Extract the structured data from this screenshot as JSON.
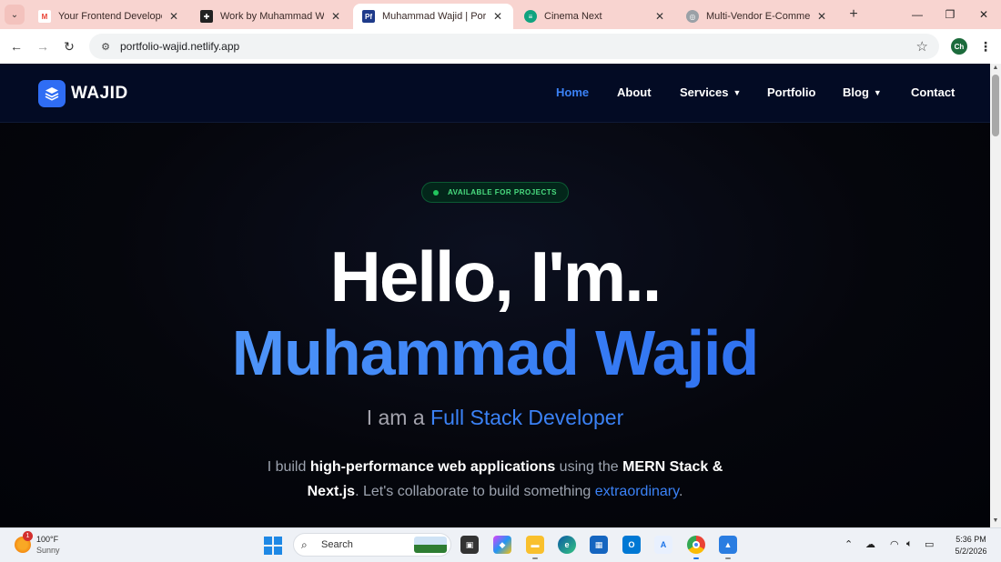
{
  "browser": {
    "tabs": [
      {
        "title": "Your Frontend Developer (Re",
        "favicon": "gmail-icon",
        "active": false
      },
      {
        "title": "Work by Muhammad Wajid",
        "favicon": "work-site-icon",
        "active": false
      },
      {
        "title": "Muhammad Wajid | Portfolio",
        "favicon": "portfolio-icon",
        "active": true
      },
      {
        "title": "Cinema Next",
        "favicon": "cinema-icon",
        "active": false
      },
      {
        "title": "Multi-Vendor E-Commerce P",
        "favicon": "globe-icon",
        "active": false
      }
    ],
    "url": "portfolio-wajid.netlify.app",
    "profile_initials": "Ch"
  },
  "site": {
    "logo_text": "WAJID",
    "nav": [
      {
        "label": "Home",
        "active": true,
        "dropdown": false
      },
      {
        "label": "About",
        "active": false,
        "dropdown": false
      },
      {
        "label": "Services",
        "active": false,
        "dropdown": true
      },
      {
        "label": "Portfolio",
        "active": false,
        "dropdown": false
      },
      {
        "label": "Blog",
        "active": false,
        "dropdown": true
      },
      {
        "label": "Contact",
        "active": false,
        "dropdown": false
      }
    ],
    "accent_color": "#3b82f6"
  },
  "hero": {
    "badge": "AVAILABLE FOR PROJECTS",
    "greeting": "Hello, I'm..",
    "name": "Muhammad Wajid",
    "role_prefix": "I am a",
    "role": "Full Stack Developer",
    "desc": {
      "p1": "I build",
      "b1": "high-performance web applications",
      "p2": "using the",
      "b2": "MERN Stack & Next.js",
      "p3": ". Let's collaborate to build something",
      "hl": "extraordinary",
      "p4": "."
    }
  },
  "taskbar": {
    "weather_temp": "100°F",
    "weather_desc": "Sunny",
    "weather_badge": "1",
    "search_placeholder": "Search",
    "time": "5:36 PM",
    "date": "5/2/2026"
  }
}
